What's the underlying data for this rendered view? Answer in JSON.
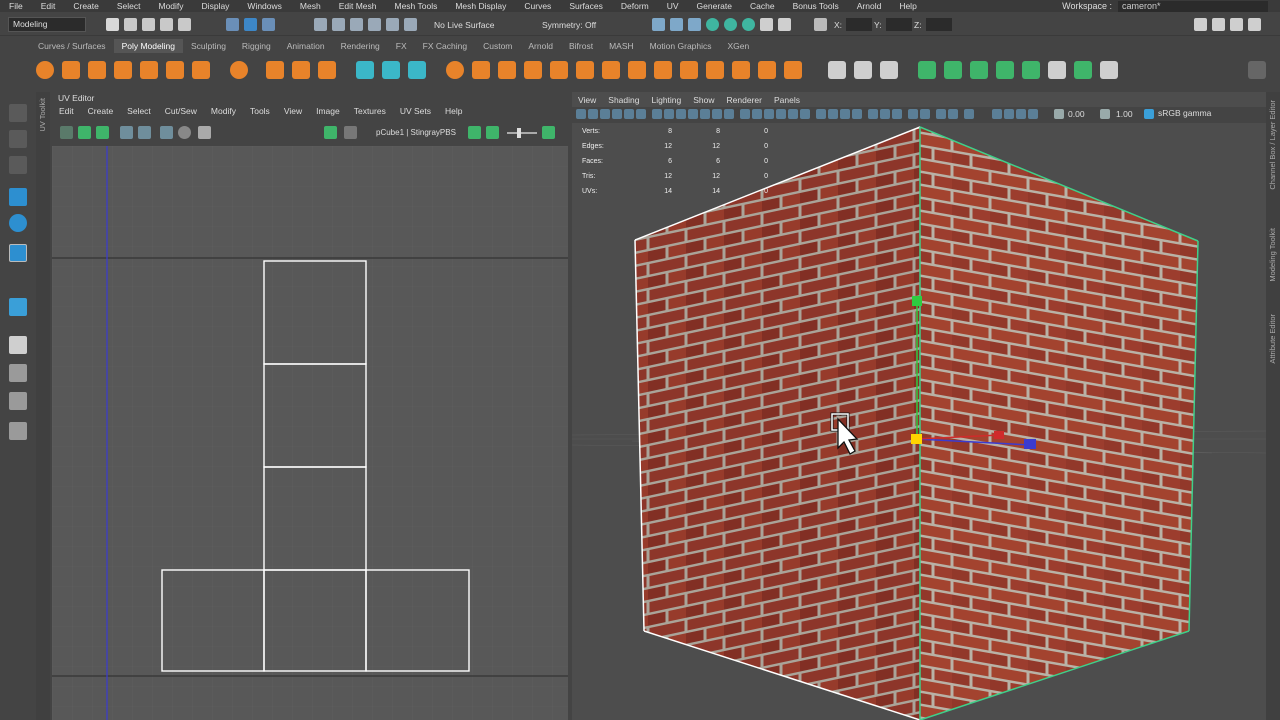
{
  "menubar": {
    "items": [
      "File",
      "Edit",
      "Create",
      "Select",
      "Modify",
      "Display",
      "Windows",
      "Mesh",
      "Edit Mesh",
      "Mesh Tools",
      "Mesh Display",
      "Curves",
      "Surfaces",
      "Deform",
      "UV",
      "Generate",
      "Cache",
      "Bonus Tools",
      "Arnold",
      "Help"
    ],
    "workspace_label": "Workspace :",
    "workspace_value": "cameron*"
  },
  "statusline": {
    "mode": "Modeling",
    "live_surface": "No Live Surface",
    "symmetry": "Symmetry: Off",
    "x_label": "X:",
    "y_label": "Y:",
    "z_label": "Z:"
  },
  "shelf": {
    "tabs": [
      "Curves / Surfaces",
      "Poly Modeling",
      "Sculpting",
      "Rigging",
      "Animation",
      "Rendering",
      "FX",
      "FX Caching",
      "Custom",
      "Arnold",
      "Bifrost",
      "MASH",
      "Motion Graphics",
      "XGen"
    ],
    "active_tab": 1
  },
  "uv_toolkit": {
    "label": "UV Toolkit"
  },
  "uv_editor": {
    "title": "UV Editor",
    "menu": [
      "Edit",
      "Create",
      "Select",
      "Cut/Sew",
      "Modify",
      "Tools",
      "View",
      "Image",
      "Textures",
      "UV Sets",
      "Help"
    ],
    "shader_label": "pCube1 | StingrayPBS"
  },
  "viewport": {
    "menu": [
      "View",
      "Shading",
      "Lighting",
      "Show",
      "Renderer",
      "Panels"
    ],
    "exposure": "0.00",
    "gamma_value": "1.00",
    "color_space": "sRGB gamma",
    "hud": [
      {
        "label": "Verts:",
        "c1": "8",
        "c2": "8",
        "c3": "0"
      },
      {
        "label": "Edges:",
        "c1": "12",
        "c2": "12",
        "c3": "0"
      },
      {
        "label": "Faces:",
        "c1": "6",
        "c2": "6",
        "c3": "0"
      },
      {
        "label": "Tris:",
        "c1": "12",
        "c2": "12",
        "c3": "0"
      },
      {
        "label": "UVs:",
        "c1": "14",
        "c2": "14",
        "c3": "0"
      }
    ]
  },
  "right_tabs": [
    "Channel Box / Layer Editor",
    "Modeling Toolkit",
    "Attribute Editor"
  ],
  "colors": {
    "shelf_orange": "#e8832a",
    "shelf_green": "#3fb56a",
    "brick": "#9a3b2e",
    "mortar": "#b9b2a6",
    "uv_line": "#ffffff",
    "axis_blue": "#3b3bd0"
  }
}
